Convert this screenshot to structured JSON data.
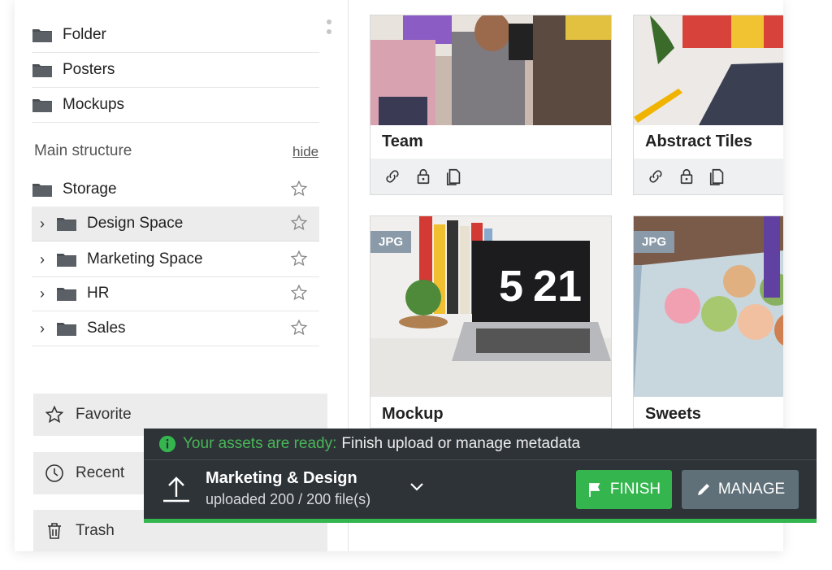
{
  "sidebar": {
    "folders": [
      {
        "label": "Folder"
      },
      {
        "label": "Posters"
      },
      {
        "label": "Mockups"
      }
    ],
    "main_structure_title": "Main structure",
    "hide_label": "hide",
    "structure": [
      {
        "label": "Storage",
        "expandable": false,
        "selected": false
      },
      {
        "label": "Design Space",
        "expandable": true,
        "selected": true
      },
      {
        "label": "Marketing Space",
        "expandable": true,
        "selected": false
      },
      {
        "label": "HR",
        "expandable": true,
        "selected": false
      },
      {
        "label": "Sales",
        "expandable": true,
        "selected": false
      }
    ],
    "nav": [
      {
        "label": "Favorite",
        "icon": "star-icon"
      },
      {
        "label": "Recent",
        "icon": "clock-icon"
      },
      {
        "label": "Trash",
        "icon": "trash-icon"
      }
    ]
  },
  "cards": [
    {
      "title": "Team",
      "badge": ""
    },
    {
      "title": "Abstract Tiles",
      "badge": ""
    },
    {
      "title": "Mockup",
      "badge": "JPG"
    },
    {
      "title": "Sweets",
      "badge": "JPG"
    }
  ],
  "upload": {
    "ready_text": "Your assets are ready:",
    "rest_text": "Finish upload or manage metadata",
    "name": "Marketing & Design",
    "count_text": "uploaded 200 / 200 file(s)",
    "progress": 1.0,
    "finish_label": "FINISH",
    "manage_label": "MANAGE"
  },
  "colors": {
    "accent_green": "#34b54e",
    "bar_bg": "#2e3338",
    "manage_bg": "#5f7079",
    "badge_bg": "#8a9aa8"
  }
}
